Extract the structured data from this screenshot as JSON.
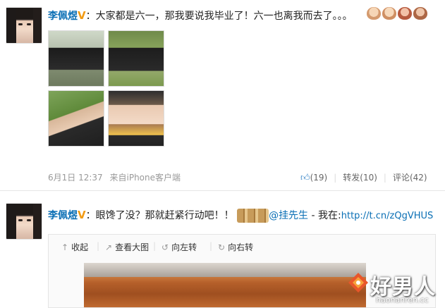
{
  "post1": {
    "username": "李佩煜",
    "verified_badge": "V",
    "colon": "：",
    "text": "大家都是六一，那我要说我毕业了！六一也离我而去了。。。",
    "emoticons": [
      "bear-emoticon",
      "bear-emoticon",
      "bear-emoticon",
      "bear-emoticon"
    ],
    "timestamp": "6月1日 12:37",
    "source": "来自iPhone客户端",
    "like_count": "(19)",
    "repost_label": "转发(10)",
    "comment_label": "评论(42)"
  },
  "post2": {
    "username": "李佩煜",
    "verified_badge": "V",
    "colon": "：",
    "text": "眼馋了没？那就赶紧行动吧！！",
    "mention": "@挂先生",
    "at_label": " - 我在:",
    "short_url": "http://t.cn/zQgVHUS",
    "toolbar": {
      "collapse": "收起",
      "view_large": "查看大图",
      "rotate_left": "向左转",
      "rotate_right": "向右转"
    }
  },
  "watermark": {
    "brand": "好男人",
    "domain": "haonanren.cc"
  },
  "colors": {
    "link": "#0a6fb5",
    "badge": "#f19a13",
    "meta": "#999999",
    "divider": "#e6e6e6"
  }
}
